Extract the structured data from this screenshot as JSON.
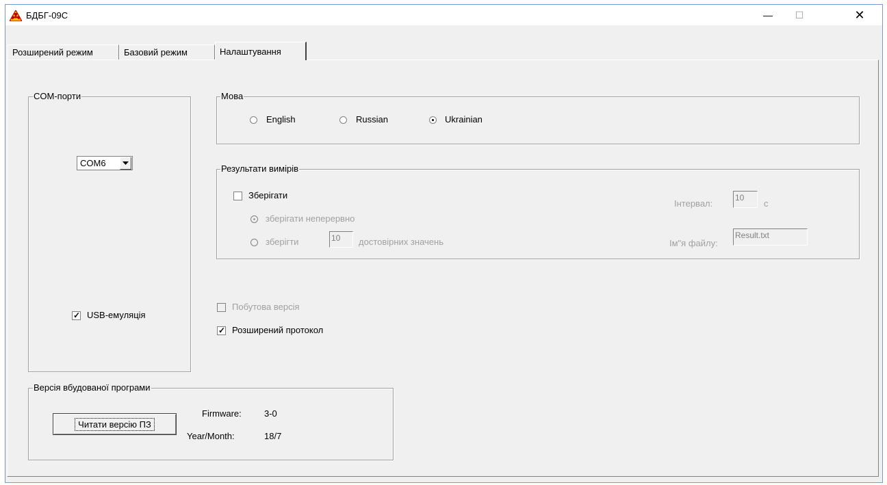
{
  "window": {
    "title": "БДБГ-09С",
    "minimize_glyph": "—",
    "maximize_glyph": "☐",
    "close_glyph": "✕",
    "icon": "warning-radiation-icon"
  },
  "tabs": [
    {
      "label": "Розширений режим",
      "active": false
    },
    {
      "label": "Базовий режим",
      "active": false
    },
    {
      "label": "Налаштування",
      "active": true
    }
  ],
  "com_ports": {
    "title": "COM-порти",
    "selected": "COM6",
    "usb_emulation_label": "USB-емуляція",
    "usb_emulation_checked": true
  },
  "language": {
    "title": "Мова",
    "options": [
      "English",
      "Russian",
      "Ukrainian"
    ],
    "selected": "Ukrainian"
  },
  "results": {
    "title": "Результати вимірів",
    "save_label": "Зберігати",
    "save_checked": false,
    "save_continuous_label": "зберігати неперервно",
    "save_n_label": "зберігти",
    "save_n_value": "10",
    "save_n_suffix": "достовірних значень",
    "interval_label": "Інтервал:",
    "interval_value": "10",
    "interval_unit": "с",
    "filename_label": "Ім\"я файлу:",
    "filename_value": "Result.txt"
  },
  "options": {
    "household_label": "Побутова версія",
    "household_checked": false,
    "extended_protocol_label": "Розширений протокол",
    "extended_protocol_checked": true
  },
  "firmware": {
    "title": "Версія вбудованої програми",
    "read_button": "Читати версію ПЗ",
    "firmware_label": "Firmware:",
    "firmware_value": "3-0",
    "date_label": "Year/Month:",
    "date_value": "18/7"
  }
}
